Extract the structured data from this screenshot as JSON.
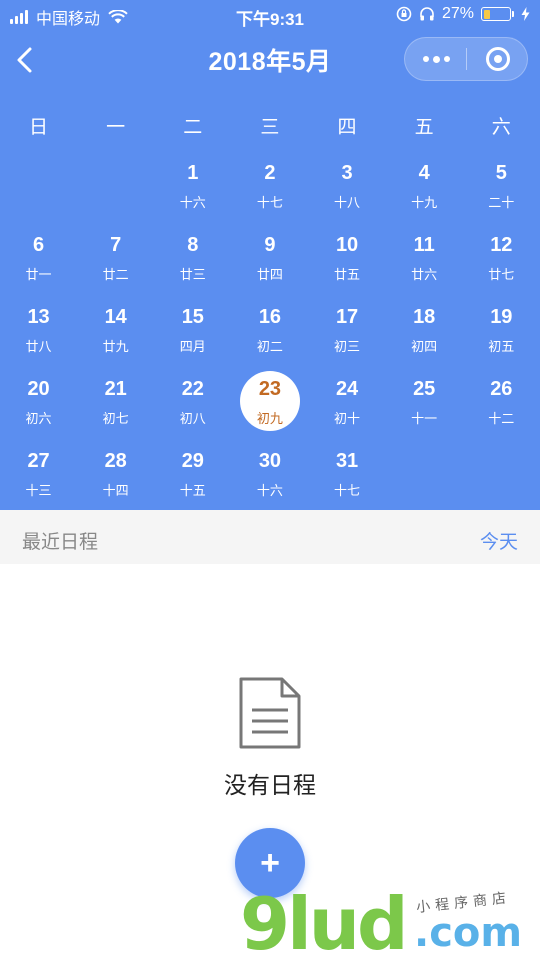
{
  "status_bar": {
    "carrier": "中国移动",
    "time": "下午9:31",
    "battery_percent": "27%",
    "battery_level": 0.27
  },
  "nav": {
    "title": "2018年5月",
    "back_icon": "chevron-left-icon",
    "more_icon": "more-dots-icon",
    "close_icon": "target-icon"
  },
  "calendar": {
    "weekdays": [
      "日",
      "一",
      "二",
      "三",
      "四",
      "五",
      "六"
    ],
    "today": "23",
    "weeks": [
      [
        null,
        null,
        {
          "day": "1",
          "lunar": "十六"
        },
        {
          "day": "2",
          "lunar": "十七"
        },
        {
          "day": "3",
          "lunar": "十八"
        },
        {
          "day": "4",
          "lunar": "十九"
        },
        {
          "day": "5",
          "lunar": "二十"
        }
      ],
      [
        {
          "day": "6",
          "lunar": "廿一"
        },
        {
          "day": "7",
          "lunar": "廿二"
        },
        {
          "day": "8",
          "lunar": "廿三"
        },
        {
          "day": "9",
          "lunar": "廿四"
        },
        {
          "day": "10",
          "lunar": "廿五"
        },
        {
          "day": "11",
          "lunar": "廿六"
        },
        {
          "day": "12",
          "lunar": "廿七"
        }
      ],
      [
        {
          "day": "13",
          "lunar": "廿八"
        },
        {
          "day": "14",
          "lunar": "廿九"
        },
        {
          "day": "15",
          "lunar": "四月"
        },
        {
          "day": "16",
          "lunar": "初二"
        },
        {
          "day": "17",
          "lunar": "初三"
        },
        {
          "day": "18",
          "lunar": "初四"
        },
        {
          "day": "19",
          "lunar": "初五"
        }
      ],
      [
        {
          "day": "20",
          "lunar": "初六"
        },
        {
          "day": "21",
          "lunar": "初七"
        },
        {
          "day": "22",
          "lunar": "初八"
        },
        {
          "day": "23",
          "lunar": "初九"
        },
        {
          "day": "24",
          "lunar": "初十"
        },
        {
          "day": "25",
          "lunar": "十一"
        },
        {
          "day": "26",
          "lunar": "十二"
        }
      ],
      [
        {
          "day": "27",
          "lunar": "十三"
        },
        {
          "day": "28",
          "lunar": "十四"
        },
        {
          "day": "29",
          "lunar": "十五"
        },
        {
          "day": "30",
          "lunar": "十六"
        },
        {
          "day": "31",
          "lunar": "十七"
        },
        null,
        null
      ]
    ]
  },
  "recent": {
    "title": "最近日程",
    "today_label": "今天"
  },
  "empty_state": {
    "text": "没有日程",
    "icon": "document-icon"
  },
  "fab": {
    "label": "+"
  },
  "watermark": {
    "main": "9lud",
    "domain": ".com",
    "subtitle": "小程序商店"
  },
  "colors": {
    "primary": "#5b8ef0",
    "today_text": "#c26a23",
    "battery": "#f7c948",
    "section_bg": "#f5f5f5"
  }
}
